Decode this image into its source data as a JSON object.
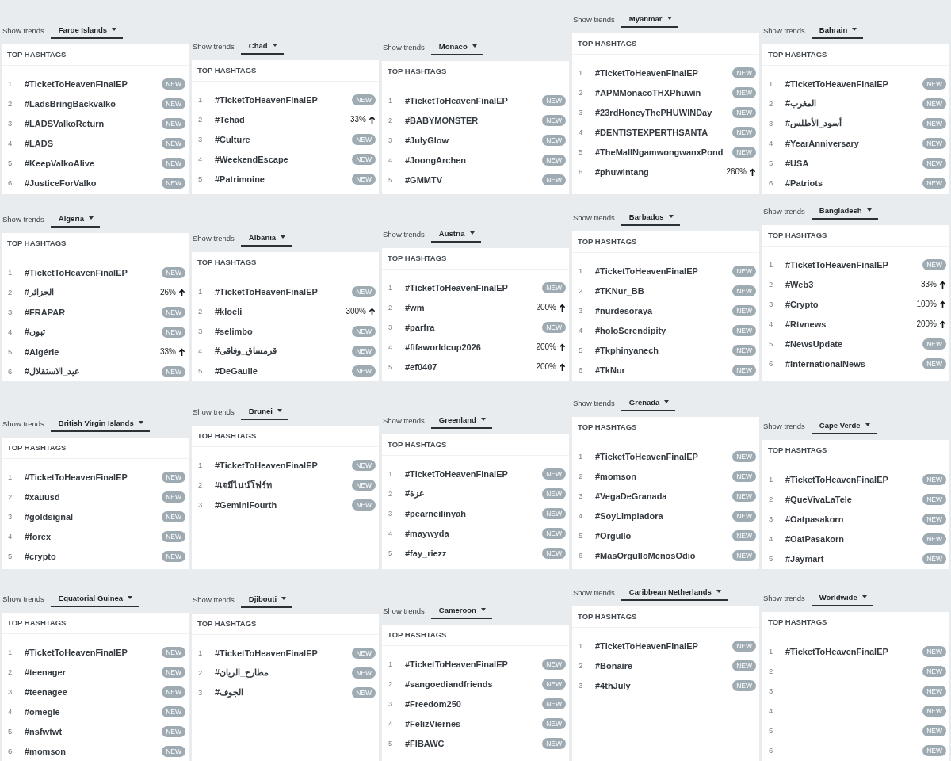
{
  "panels": [
    {
      "label": "Show trends",
      "country": "Faroe Islands",
      "heading": "TOP HASHTAGS",
      "trends": [
        {
          "rank": "1",
          "tag": "#TicketToHeavenFinalEP",
          "kind": "new",
          "badge": "NEW"
        },
        {
          "rank": "2",
          "tag": "#LadsBringBackvalko",
          "kind": "new",
          "badge": "NEW"
        },
        {
          "rank": "3",
          "tag": "#LADSValkoReturn",
          "kind": "new",
          "badge": "NEW"
        },
        {
          "rank": "4",
          "tag": "#LADS",
          "kind": "new",
          "badge": "NEW"
        },
        {
          "rank": "5",
          "tag": "#KeepValkoAlive",
          "kind": "new",
          "badge": "NEW"
        },
        {
          "rank": "6",
          "tag": "#JusticeForValko",
          "kind": "new",
          "badge": "NEW"
        }
      ]
    },
    {
      "label": "Show trends",
      "country": "Chad",
      "heading": "TOP HASHTAGS",
      "trends": [
        {
          "rank": "1",
          "tag": "#TicketToHeavenFinalEP",
          "kind": "new",
          "badge": "NEW"
        },
        {
          "rank": "2",
          "tag": "#Tchad",
          "kind": "rise",
          "change": "33%"
        },
        {
          "rank": "3",
          "tag": "#Culture",
          "kind": "new",
          "badge": "NEW"
        },
        {
          "rank": "4",
          "tag": "#WeekendEscape",
          "kind": "new",
          "badge": "NEW"
        },
        {
          "rank": "5",
          "tag": "#Patrimoine",
          "kind": "new",
          "badge": "NEW"
        }
      ]
    },
    {
      "label": "Show trends",
      "country": "Monaco",
      "heading": "TOP HASHTAGS",
      "trends": [
        {
          "rank": "1",
          "tag": "#TicketToHeavenFinalEP",
          "kind": "new",
          "badge": "NEW"
        },
        {
          "rank": "2",
          "tag": "#BABYMONSTER",
          "kind": "new",
          "badge": "NEW"
        },
        {
          "rank": "3",
          "tag": "#JulyGlow",
          "kind": "new",
          "badge": "NEW"
        },
        {
          "rank": "4",
          "tag": "#JoongArchen",
          "kind": "new",
          "badge": "NEW"
        },
        {
          "rank": "5",
          "tag": "#GMMTV",
          "kind": "new",
          "badge": "NEW"
        }
      ]
    },
    {
      "label": "Show trends",
      "country": "Myanmar",
      "heading": "TOP HASHTAGS",
      "trends": [
        {
          "rank": "1",
          "tag": "#TicketToHeavenFinalEP",
          "kind": "new",
          "badge": "NEW"
        },
        {
          "rank": "2",
          "tag": "#APMMonacoTHXPhuwin",
          "kind": "new",
          "badge": "NEW"
        },
        {
          "rank": "3",
          "tag": "#23rdHoneyThePHUWINDay",
          "kind": "new",
          "badge": "NEW"
        },
        {
          "rank": "4",
          "tag": "#DENTISTEXPERTHSANTA",
          "kind": "new",
          "badge": "NEW"
        },
        {
          "rank": "5",
          "tag": "#TheMallNgamwongwanxPond",
          "kind": "new",
          "badge": "NEW"
        },
        {
          "rank": "6",
          "tag": "#phuwintang",
          "kind": "rise",
          "change": "260%"
        }
      ]
    },
    {
      "label": "Show trends",
      "country": "Bahrain",
      "heading": "TOP HASHTAGS",
      "trends": [
        {
          "rank": "1",
          "tag": "#TicketToHeavenFinalEP",
          "kind": "new",
          "badge": "NEW"
        },
        {
          "rank": "2",
          "tag": "#المغرب",
          "kind": "new",
          "badge": "NEW"
        },
        {
          "rank": "3",
          "tag": "#أسود_الأطلس",
          "kind": "new",
          "badge": "NEW"
        },
        {
          "rank": "4",
          "tag": "#YearAnniversary",
          "kind": "new",
          "badge": "NEW"
        },
        {
          "rank": "5",
          "tag": "#USA",
          "kind": "new",
          "badge": "NEW"
        },
        {
          "rank": "6",
          "tag": "#Patriots",
          "kind": "new",
          "badge": "NEW"
        }
      ]
    },
    {
      "label": "Show trends",
      "country": "Algeria",
      "heading": "TOP HASHTAGS",
      "trends": [
        {
          "rank": "1",
          "tag": "#TicketToHeavenFinalEP",
          "kind": "new",
          "badge": "NEW"
        },
        {
          "rank": "2",
          "tag": "#الجزائر",
          "kind": "rise",
          "change": "26%"
        },
        {
          "rank": "3",
          "tag": "#FRAPAR",
          "kind": "new",
          "badge": "NEW"
        },
        {
          "rank": "4",
          "tag": "#تبون",
          "kind": "new",
          "badge": "NEW"
        },
        {
          "rank": "5",
          "tag": "#Algérie",
          "kind": "rise",
          "change": "33%"
        },
        {
          "rank": "6",
          "tag": "#عيد_الاستقلال",
          "kind": "new",
          "badge": "NEW"
        }
      ]
    },
    {
      "label": "Show trends",
      "country": "Albania",
      "heading": "TOP HASHTAGS",
      "trends": [
        {
          "rank": "1",
          "tag": "#TicketToHeavenFinalEP",
          "kind": "new",
          "badge": "NEW"
        },
        {
          "rank": "2",
          "tag": "#kloeli",
          "kind": "rise",
          "change": "300%"
        },
        {
          "rank": "3",
          "tag": "#selimbo",
          "kind": "new",
          "badge": "NEW"
        },
        {
          "rank": "4",
          "tag": "#قرمساق_وفاقى",
          "kind": "new",
          "badge": "NEW"
        },
        {
          "rank": "5",
          "tag": "#DeGaulle",
          "kind": "new",
          "badge": "NEW"
        }
      ]
    },
    {
      "label": "Show trends",
      "country": "Austria",
      "heading": "TOP HASHTAGS",
      "trends": [
        {
          "rank": "1",
          "tag": "#TicketToHeavenFinalEP",
          "kind": "new",
          "badge": "NEW"
        },
        {
          "rank": "2",
          "tag": "#wm",
          "kind": "rise",
          "change": "200%"
        },
        {
          "rank": "3",
          "tag": "#parfra",
          "kind": "new",
          "badge": "NEW"
        },
        {
          "rank": "4",
          "tag": "#fifaworldcup2026",
          "kind": "rise",
          "change": "200%"
        },
        {
          "rank": "5",
          "tag": "#ef0407",
          "kind": "rise",
          "change": "200%"
        }
      ]
    },
    {
      "label": "Show trends",
      "country": "Barbados",
      "heading": "TOP HASHTAGS",
      "trends": [
        {
          "rank": "1",
          "tag": "#TicketToHeavenFinalEP",
          "kind": "new",
          "badge": "NEW"
        },
        {
          "rank": "2",
          "tag": "#TKNur_BB",
          "kind": "new",
          "badge": "NEW"
        },
        {
          "rank": "3",
          "tag": "#nurdesoraya",
          "kind": "new",
          "badge": "NEW"
        },
        {
          "rank": "4",
          "tag": "#holoSerendipity",
          "kind": "new",
          "badge": "NEW"
        },
        {
          "rank": "5",
          "tag": "#Tkphinyanech",
          "kind": "new",
          "badge": "NEW"
        },
        {
          "rank": "6",
          "tag": "#TkNur",
          "kind": "new",
          "badge": "NEW"
        }
      ]
    },
    {
      "label": "Show trends",
      "country": "Bangladesh",
      "heading": "TOP HASHTAGS",
      "trends": [
        {
          "rank": "1",
          "tag": "#TicketToHeavenFinalEP",
          "kind": "new",
          "badge": "NEW"
        },
        {
          "rank": "2",
          "tag": "#Web3",
          "kind": "rise",
          "change": "33%"
        },
        {
          "rank": "3",
          "tag": "#Crypto",
          "kind": "rise",
          "change": "100%"
        },
        {
          "rank": "4",
          "tag": "#Rtvnews",
          "kind": "rise",
          "change": "200%"
        },
        {
          "rank": "5",
          "tag": "#NewsUpdate",
          "kind": "new",
          "badge": "NEW"
        },
        {
          "rank": "6",
          "tag": "#InternationalNews",
          "kind": "new",
          "badge": "NEW"
        }
      ]
    },
    {
      "label": "Show trends",
      "country": "British Virgin Islands",
      "heading": "TOP HASHTAGS",
      "trends": [
        {
          "rank": "1",
          "tag": "#TicketToHeavenFinalEP",
          "kind": "new",
          "badge": "NEW"
        },
        {
          "rank": "2",
          "tag": "#xauusd",
          "kind": "new",
          "badge": "NEW"
        },
        {
          "rank": "3",
          "tag": "#goldsignal",
          "kind": "new",
          "badge": "NEW"
        },
        {
          "rank": "4",
          "tag": "#forex",
          "kind": "new",
          "badge": "NEW"
        },
        {
          "rank": "5",
          "tag": "#crypto",
          "kind": "new",
          "badge": "NEW"
        }
      ]
    },
    {
      "label": "Show trends",
      "country": "Brunei",
      "heading": "TOP HASHTAGS",
      "trends": [
        {
          "rank": "1",
          "tag": "#TicketToHeavenFinalEP",
          "kind": "new",
          "badge": "NEW"
        },
        {
          "rank": "2",
          "tag": "#เจมีไนน์โฟร์ท",
          "kind": "new",
          "badge": "NEW"
        },
        {
          "rank": "3",
          "tag": "#GeminiFourth",
          "kind": "new",
          "badge": "NEW"
        }
      ]
    },
    {
      "label": "Show trends",
      "country": "Greenland",
      "heading": "TOP HASHTAGS",
      "trends": [
        {
          "rank": "1",
          "tag": "#TicketToHeavenFinalEP",
          "kind": "new",
          "badge": "NEW"
        },
        {
          "rank": "2",
          "tag": "#غزة",
          "kind": "new",
          "badge": "NEW"
        },
        {
          "rank": "3",
          "tag": "#pearneilinyah",
          "kind": "new",
          "badge": "NEW"
        },
        {
          "rank": "4",
          "tag": "#maywyda",
          "kind": "new",
          "badge": "NEW"
        },
        {
          "rank": "5",
          "tag": "#fay_riezz",
          "kind": "new",
          "badge": "NEW"
        }
      ]
    },
    {
      "label": "Show trends",
      "country": "Grenada",
      "heading": "TOP HASHTAGS",
      "trends": [
        {
          "rank": "1",
          "tag": "#TicketToHeavenFinalEP",
          "kind": "new",
          "badge": "NEW"
        },
        {
          "rank": "2",
          "tag": "#momson",
          "kind": "new",
          "badge": "NEW"
        },
        {
          "rank": "3",
          "tag": "#VegaDeGranada",
          "kind": "new",
          "badge": "NEW"
        },
        {
          "rank": "4",
          "tag": "#SoyLimpiadora",
          "kind": "new",
          "badge": "NEW"
        },
        {
          "rank": "5",
          "tag": "#Orgullo",
          "kind": "new",
          "badge": "NEW"
        },
        {
          "rank": "6",
          "tag": "#MasOrgulloMenosOdio",
          "kind": "new",
          "badge": "NEW"
        }
      ]
    },
    {
      "label": "Show trends",
      "country": "Cape Verde",
      "heading": "TOP HASHTAGS",
      "trends": [
        {
          "rank": "1",
          "tag": "#TicketToHeavenFinalEP",
          "kind": "new",
          "badge": "NEW"
        },
        {
          "rank": "2",
          "tag": "#QueVivaLaTele",
          "kind": "new",
          "badge": "NEW"
        },
        {
          "rank": "3",
          "tag": "#Oatpasakorn",
          "kind": "new",
          "badge": "NEW"
        },
        {
          "rank": "4",
          "tag": "#OatPasakorn",
          "kind": "new",
          "badge": "NEW"
        },
        {
          "rank": "5",
          "tag": "#Jaymart",
          "kind": "new",
          "badge": "NEW"
        }
      ]
    },
    {
      "label": "Show trends",
      "country": "Equatorial Guinea",
      "heading": "TOP HASHTAGS",
      "trends": [
        {
          "rank": "1",
          "tag": "#TicketToHeavenFinalEP",
          "kind": "new",
          "badge": "NEW"
        },
        {
          "rank": "2",
          "tag": "#teenager",
          "kind": "new",
          "badge": "NEW"
        },
        {
          "rank": "3",
          "tag": "#teenagee",
          "kind": "new",
          "badge": "NEW"
        },
        {
          "rank": "4",
          "tag": "#omegle",
          "kind": "new",
          "badge": "NEW"
        },
        {
          "rank": "5",
          "tag": "#nsfwtwt",
          "kind": "new",
          "badge": "NEW"
        },
        {
          "rank": "6",
          "tag": "#momson",
          "kind": "new",
          "badge": "NEW"
        }
      ]
    },
    {
      "label": "Show trends",
      "country": "Djibouti",
      "heading": "TOP HASHTAGS",
      "trends": [
        {
          "rank": "1",
          "tag": "#TicketToHeavenFinalEP",
          "kind": "new",
          "badge": "NEW"
        },
        {
          "rank": "2",
          "tag": "#مطارح_الريان",
          "kind": "new",
          "badge": "NEW"
        },
        {
          "rank": "3",
          "tag": "#الجوف",
          "kind": "new",
          "badge": "NEW"
        }
      ]
    },
    {
      "label": "Show trends",
      "country": "Cameroon",
      "heading": "TOP HASHTAGS",
      "trends": [
        {
          "rank": "1",
          "tag": "#TicketToHeavenFinalEP",
          "kind": "new",
          "badge": "NEW"
        },
        {
          "rank": "2",
          "tag": "#sangoediandfriends",
          "kind": "new",
          "badge": "NEW"
        },
        {
          "rank": "3",
          "tag": "#Freedom250",
          "kind": "new",
          "badge": "NEW"
        },
        {
          "rank": "4",
          "tag": "#FelizViernes",
          "kind": "new",
          "badge": "NEW"
        },
        {
          "rank": "5",
          "tag": "#FIBAWC",
          "kind": "new",
          "badge": "NEW"
        }
      ]
    },
    {
      "label": "Show trends",
      "country": "Caribbean Netherlands",
      "heading": "TOP HASHTAGS",
      "trends": [
        {
          "rank": "1",
          "tag": "#TicketToHeavenFinalEP",
          "kind": "new",
          "badge": "NEW"
        },
        {
          "rank": "2",
          "tag": "#Bonaire",
          "kind": "new",
          "badge": "NEW"
        },
        {
          "rank": "3",
          "tag": "#4thJuly",
          "kind": "new",
          "badge": "NEW"
        }
      ]
    },
    {
      "label": "Show trends",
      "country": "Worldwide",
      "heading": "TOP HASHTAGS",
      "trends": [
        {
          "rank": "1",
          "tag": "#TicketToHeavenFinalEP",
          "kind": "new",
          "badge": "NEW"
        },
        {
          "rank": "2",
          "kind": "new",
          "badge": "NEW"
        },
        {
          "rank": "3",
          "kind": "new",
          "badge": "NEW"
        },
        {
          "rank": "4",
          "kind": "new",
          "badge": "NEW"
        },
        {
          "rank": "5",
          "kind": "new",
          "badge": "NEW"
        },
        {
          "rank": "6",
          "kind": "new",
          "badge": "NEW"
        }
      ]
    }
  ]
}
